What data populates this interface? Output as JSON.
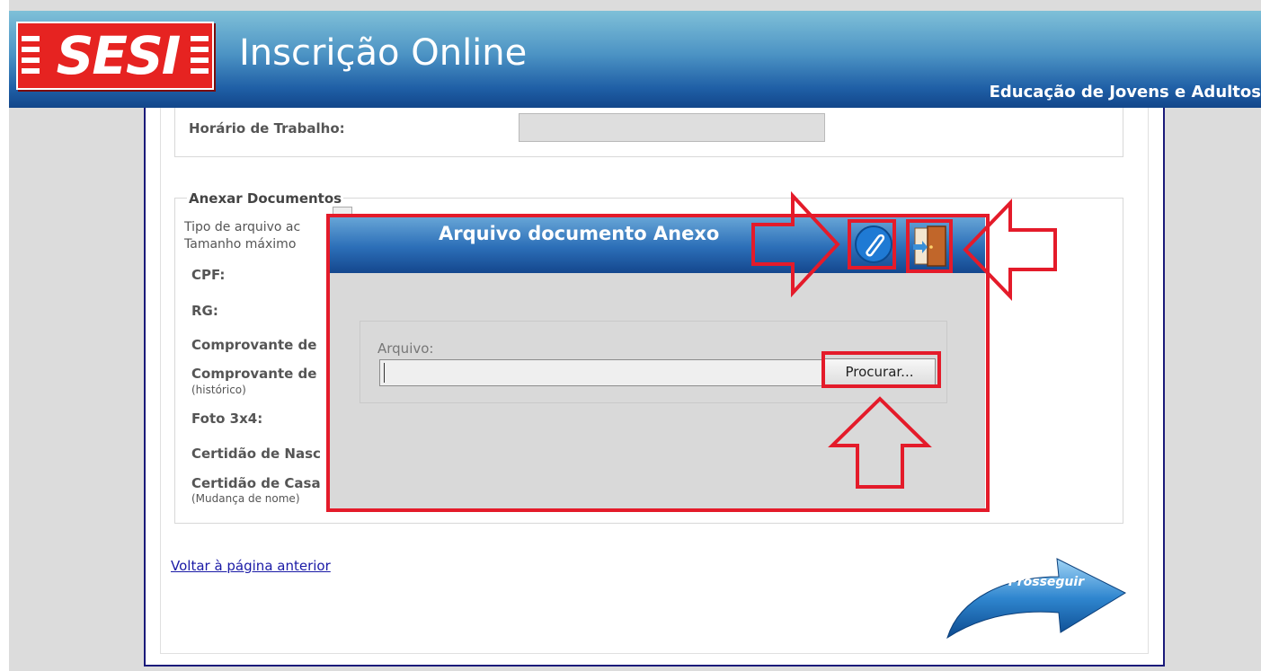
{
  "header": {
    "logo_text": "SESI",
    "title": "Inscrição Online",
    "subtitle": "Educação de Jovens e Adultos"
  },
  "form": {
    "work_hours_label": "Horário de Trabalho:",
    "documents_legend": "Anexar Documentos",
    "file_type_text": "Tipo de arquivo ac",
    "max_size_text": "Tamanho máximo",
    "fields": {
      "cpf": "CPF:",
      "rg": "RG:",
      "comprovante1": "Comprovante de",
      "comprovante2": "Comprovante de",
      "comprovante2_note": "(histórico)",
      "foto": "Foto 3x4:",
      "certidao_nasc": "Certidão de Nasc",
      "certidao_casa": "Certidão de Casa",
      "certidao_casa_note": "(Mudança de nome)"
    },
    "back_link": "Voltar à página anterior",
    "proceed_label": "Prosseguir"
  },
  "modal": {
    "title": "Arquivo documento Anexo",
    "file_label": "Arquivo:",
    "file_value": "",
    "browse_label": "Procurar...",
    "attach_icon": "paperclip-icon",
    "exit_icon": "exit-door-icon"
  },
  "colors": {
    "header_blue": "#1f5fa6",
    "sesi_red": "#e62321",
    "annotation_red": "#e41b2a",
    "link_blue": "#1a1aa6"
  }
}
